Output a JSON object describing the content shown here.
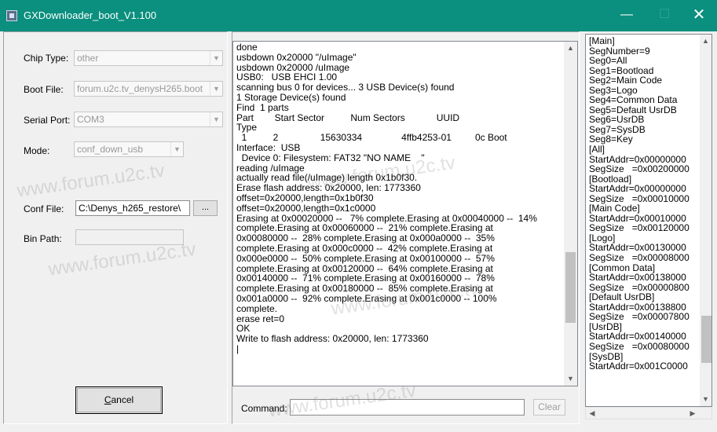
{
  "window": {
    "title": "GXDownloader_boot_V1.100",
    "minimize_glyph": "—",
    "maximize_glyph": "☐",
    "close_glyph": "✕"
  },
  "form": {
    "chip_type": {
      "label": "Chip Type:",
      "value": "other"
    },
    "boot_file": {
      "label": "Boot File:",
      "value": "forum.u2c.tv_denysH265.boot"
    },
    "serial_port": {
      "label": "Serial Port:",
      "value": "COM3"
    },
    "mode": {
      "label": "Mode:",
      "value": "conf_down_usb"
    },
    "conf_file": {
      "label": "Conf File:",
      "value": "C:\\Denys_h265_restore\\",
      "browse_label": "..."
    },
    "bin_path": {
      "label": "Bin Path:",
      "value": ""
    },
    "cancel_label_mnemonic": "C",
    "cancel_label_rest": "ancel"
  },
  "log": {
    "text": "done\nusbdown 0x20000 \"/uImage\"\nusbdown 0x20000 /uImage\nUSB0:   USB EHCI 1.00\nscanning bus 0 for devices... 3 USB Device(s) found\n1 Storage Device(s) found\nFind  1 parts\nPart        Start Sector          Num Sectors            UUID\nType\n  1          2                15630334               4ffb4253-01         0c Boot\nInterface:  USB\n  Device 0: Filesystem: FAT32 \"NO NAME    \"\nreading /uImage\nactually read file(/uImage) length 0x1b0f30.\nErase flash address: 0x20000, len: 1773360\noffset=0x20000,length=0x1b0f30\noffset=0x20000,length=0x1c0000\nErasing at 0x00020000 --   7% complete.Erasing at 0x00040000 --  14%\ncomplete.Erasing at 0x00060000 --  21% complete.Erasing at\n0x00080000 --  28% complete.Erasing at 0x000a0000 --  35%\ncomplete.Erasing at 0x000c0000 --  42% complete.Erasing at\n0x000e0000 --  50% complete.Erasing at 0x00100000 --  57%\ncomplete.Erasing at 0x00120000 --  64% complete.Erasing at\n0x00140000 --  71% complete.Erasing at 0x00160000 --  78%\ncomplete.Erasing at 0x00180000 --  85% complete.Erasing at\n0x001a0000 --  92% complete.Erasing at 0x001c0000 -- 100%\ncomplete.\nerase ret=0\nOK\nWrite to flash address: 0x20000, len: 1773360\n|",
    "scroll_position": 0.8
  },
  "command": {
    "label": "Command:",
    "value": "",
    "clear_label": "Clear"
  },
  "config": {
    "text": "[Main]\nSegNumber=9\nSeg0=All\nSeg1=Bootload\nSeg2=Main Code\nSeg3=Logo\nSeg4=Common Data\nSeg5=Default UsrDB\nSeg6=UsrDB\nSeg7=SysDB\nSeg8=Key\n[All]\nStartAddr=0x00000000\nSegSize   =0x00200000\n[Bootload]\nStartAddr=0x00000000\nSegSize   =0x00010000\n[Main Code]\nStartAddr=0x00010000\nSegSize   =0x00120000\n[Logo]\nStartAddr=0x00130000\nSegSize   =0x00008000\n[Common Data]\nStartAddr=0x00138000\nSegSize   =0x00000800\n[Default UsrDB]\nStartAddr=0x00138800\nSegSize   =0x00007800\n[UsrDB]\nStartAddr=0x00140000\nSegSize   =0x00080000\n[SysDB]\nStartAddr=0x001C0000",
    "scroll_position": 0.9
  },
  "watermark": "www.forum.u2c.tv",
  "colors": {
    "titlebar": "#0b8f7e"
  }
}
